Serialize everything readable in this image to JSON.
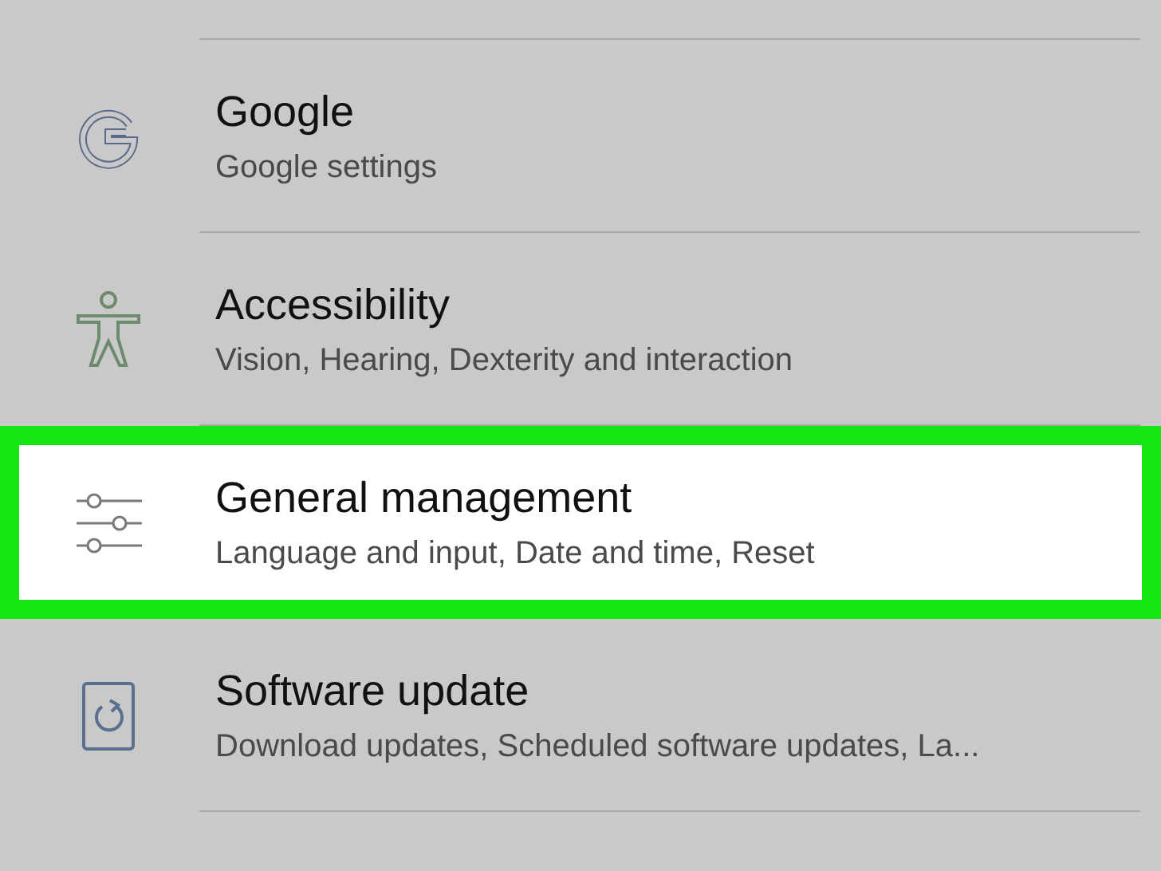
{
  "settings": [
    {
      "kind": "google",
      "title": "Google",
      "subtitle": "Google settings",
      "selected": false
    },
    {
      "kind": "accessibility",
      "title": "Accessibility",
      "subtitle": "Vision, Hearing, Dexterity and interaction",
      "selected": false
    },
    {
      "kind": "sliders",
      "title": "General management",
      "subtitle": "Language and input, Date and time, Reset",
      "selected": true
    },
    {
      "kind": "update",
      "title": "Software update",
      "subtitle": "Download updates, Scheduled software updates, La...",
      "selected": false
    }
  ]
}
